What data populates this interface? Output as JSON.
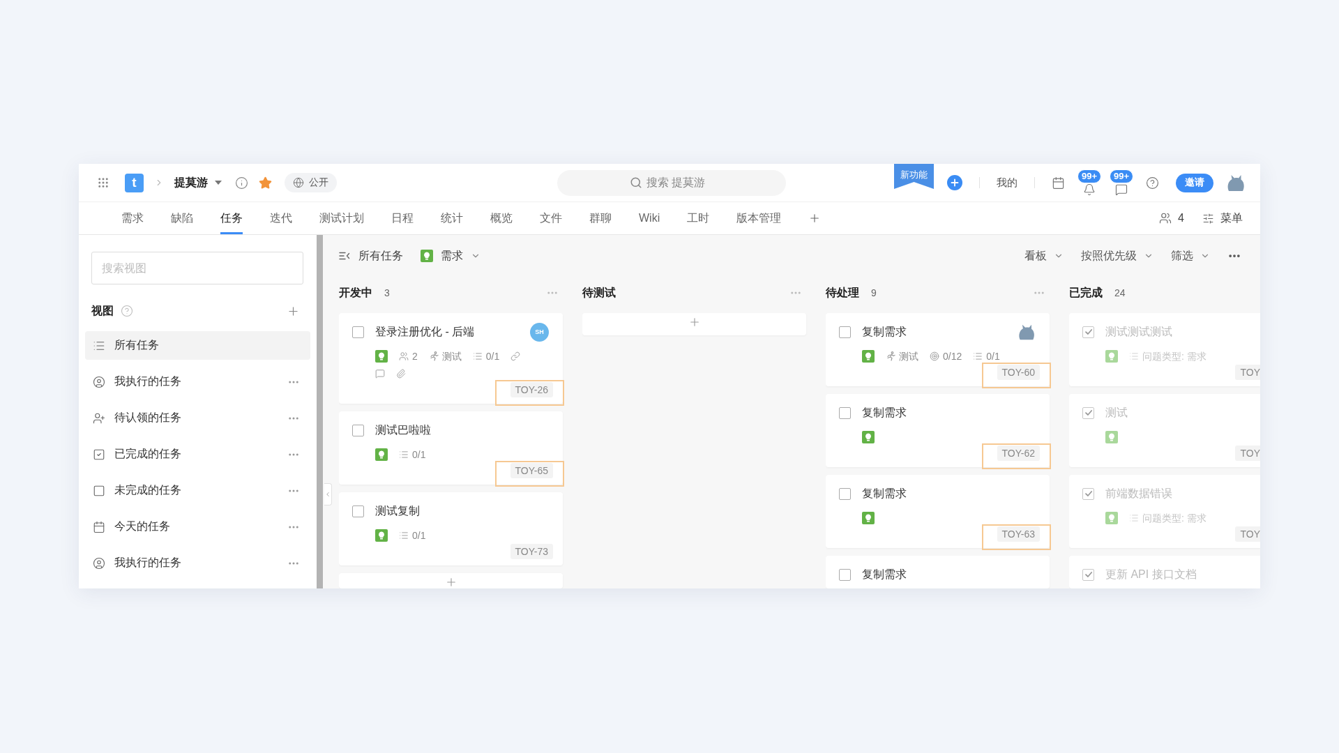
{
  "topbar": {
    "logo": "t",
    "project": "提莫游",
    "starred": true,
    "visibility": "公开",
    "search": {
      "placeholder": "搜索 提莫游"
    },
    "ribbon": "新功能",
    "mine": "我的",
    "notifications": [
      {
        "kind": "bell",
        "badge": "99+"
      },
      {
        "kind": "chat",
        "badge": "99+"
      }
    ],
    "invite": "邀请"
  },
  "tabs": [
    {
      "label": "需求",
      "selected": false
    },
    {
      "label": "缺陷",
      "selected": false
    },
    {
      "label": "任务",
      "selected": true
    },
    {
      "label": "迭代",
      "selected": false
    },
    {
      "label": "测试计划",
      "selected": false
    },
    {
      "label": "日程",
      "selected": false
    },
    {
      "label": "统计",
      "selected": false
    },
    {
      "label": "概览",
      "selected": false
    },
    {
      "label": "文件",
      "selected": false
    },
    {
      "label": "群聊",
      "selected": false
    },
    {
      "label": "Wiki",
      "selected": false
    },
    {
      "label": "工时",
      "selected": false
    },
    {
      "label": "版本管理",
      "selected": false
    }
  ],
  "tab_tools": {
    "members": "4",
    "menu": "菜单"
  },
  "sidebar": {
    "search": {
      "placeholder": "搜索视图"
    },
    "title": "视图",
    "views": [
      {
        "kind": "list",
        "label": "所有任务",
        "selected": true,
        "menu": false
      },
      {
        "kind": "person",
        "label": "我执行的任务",
        "selected": false,
        "menu": true
      },
      {
        "kind": "person_add",
        "label": "待认领的任务",
        "selected": false,
        "menu": true
      },
      {
        "kind": "checked",
        "label": "已完成的任务",
        "selected": false,
        "menu": true
      },
      {
        "kind": "unchecked",
        "label": "未完成的任务",
        "selected": false,
        "menu": true
      },
      {
        "kind": "calendar",
        "label": "今天的任务",
        "selected": false,
        "menu": true
      },
      {
        "kind": "person",
        "label": "我执行的任务",
        "selected": false,
        "menu": true
      }
    ]
  },
  "board": {
    "view": "所有任务",
    "type_filter": "需求",
    "controls": [
      "看板",
      "按照优先级",
      "筛选"
    ],
    "columns": [
      {
        "title": "开发中",
        "count": "3",
        "menu": true,
        "add_button": true,
        "cards": [
          {
            "title": "登录注册优化 - 后端",
            "done": false,
            "assignee": {
              "kind": "initials",
              "text": "SH"
            },
            "meta": [
              [
                {
                  "kind": "type"
                },
                {
                  "kind": "assignees",
                  "text": "2"
                },
                {
                  "kind": "stage",
                  "text": "测试"
                },
                {
                  "kind": "subtasks",
                  "text": "0/1"
                },
                {
                  "kind": "link"
                }
              ],
              [
                {
                  "kind": "comment"
                },
                {
                  "kind": "attachment"
                }
              ]
            ],
            "id": "TOY-26",
            "highlighted": true
          },
          {
            "title": "测试巴啦啦",
            "done": false,
            "meta": [
              [
                {
                  "kind": "type"
                },
                {
                  "kind": "subtasks",
                  "text": "0/1"
                }
              ]
            ],
            "id": "TOY-65",
            "highlighted": true
          },
          {
            "title": "测试复制",
            "done": false,
            "meta": [
              [
                {
                  "kind": "type"
                },
                {
                  "kind": "subtasks",
                  "text": "0/1"
                }
              ]
            ],
            "id": "TOY-73",
            "highlighted": false
          }
        ]
      },
      {
        "title": "待测试",
        "menu": true,
        "add_button": true
      },
      {
        "title": "待处理",
        "count": "9",
        "menu": true,
        "add_button": false,
        "cards": [
          {
            "title": "复制需求",
            "done": false,
            "assignee": {
              "kind": "picture"
            },
            "meta": [
              [
                {
                  "kind": "type"
                },
                {
                  "kind": "stage",
                  "text": "测试"
                },
                {
                  "kind": "progress",
                  "text": "0/12"
                },
                {
                  "kind": "subtasks",
                  "text": "0/1"
                }
              ]
            ],
            "id": "TOY-60",
            "highlighted": true
          },
          {
            "title": "复制需求",
            "done": false,
            "meta": [
              [
                {
                  "kind": "type"
                }
              ]
            ],
            "id": "TOY-62",
            "highlighted": true
          },
          {
            "title": "复制需求",
            "done": false,
            "meta": [
              [
                {
                  "kind": "type"
                }
              ]
            ],
            "id": "TOY-63",
            "highlighted": true
          },
          {
            "title": "复制需求",
            "done": false
          }
        ]
      },
      {
        "title": "已完成",
        "count": "24",
        "menu": false,
        "add_button": false,
        "cards": [
          {
            "title": "测试测试测试",
            "done": true,
            "meta": [
              [
                {
                  "kind": "type"
                },
                {
                  "kind": "field",
                  "text": "问题类型: 需求"
                }
              ]
            ],
            "id": "TOY",
            "highlighted": false
          },
          {
            "title": "测试",
            "done": true,
            "meta": [
              [
                {
                  "kind": "type"
                }
              ]
            ],
            "id": "TOY",
            "highlighted": false
          },
          {
            "title": "前端数据错误",
            "done": true,
            "meta": [
              [
                {
                  "kind": "type"
                },
                {
                  "kind": "field",
                  "text": "问题类型: 需求"
                }
              ]
            ],
            "id": "TOY",
            "highlighted": false
          },
          {
            "title": "更新 API 接口文档",
            "done": true
          }
        ]
      }
    ]
  }
}
